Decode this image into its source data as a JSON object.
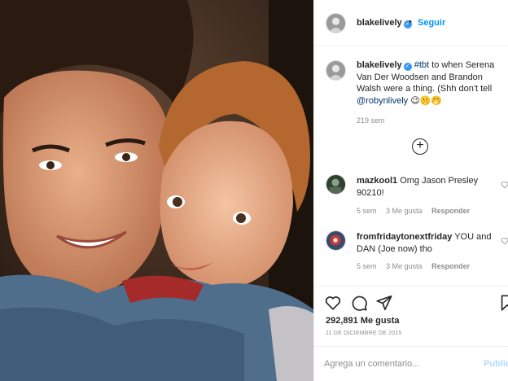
{
  "post": {
    "header": {
      "username": "blakelively",
      "verified_icon": "verified-badge-icon",
      "separator": "•",
      "follow_label": "Seguir"
    },
    "caption": {
      "username": "blakelively",
      "hashtag": "#tbt",
      "text": " to when Serena Van Der Woodsen and Brandon Walsh were a thing. (Shh don't tell ",
      "mention": "@robynlively",
      "emojis": " 😉🤫🤭",
      "time": "219 sem"
    },
    "load_more_icon": "plus-circle-icon",
    "comments": [
      {
        "username": "mazkool1",
        "text": " Omg Jason Presley 90210!",
        "time": "5 sem",
        "likes": "3 Me gusta",
        "reply_label": "Responder"
      },
      {
        "username": "fromfridaytonextfriday",
        "text": " YOU and DAN (Joe now) tho",
        "time": "5 sem",
        "likes": "3 Me gusta",
        "reply_label": "Responder"
      }
    ],
    "actions": {
      "icons": [
        "heart-icon",
        "comment-icon",
        "share-icon",
        "bookmark-icon"
      ]
    },
    "likes_count": "292,891 Me gusta",
    "date": "11 DE DICIEMBRE DE 2015",
    "add_comment": {
      "placeholder": "Agrega un comentario...",
      "publish_label": "Publicar"
    }
  },
  "colors": {
    "accent": "#0095f6",
    "verified": "#3897f0",
    "muted_text": "#8e8e8e",
    "publish_disabled": "#b3dbff"
  }
}
